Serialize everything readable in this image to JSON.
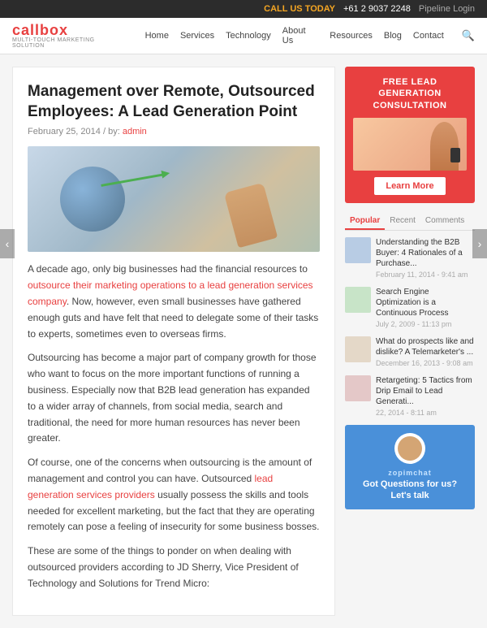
{
  "topbar": {
    "call_label": "CALL US TODAY",
    "phone": "+61 2 9037 2248",
    "pipeline_label": "Pipeline Login"
  },
  "nav": {
    "logo": "callbox",
    "logo_sub": "MULTI-TOUCH MARKETING SOLUTION",
    "links": [
      "Home",
      "Services",
      "Technology",
      "About Us",
      "Resources",
      "Blog",
      "Contact"
    ]
  },
  "article": {
    "title": "Management over Remote, Outsourced Employees: A Lead Generation Point",
    "date": "February 25, 2014",
    "separator": "/",
    "by_label": "by:",
    "author": "admin",
    "paragraphs": [
      "A decade ago, only big businesses had the financial resources to outsource their marketing operations to a lead generation services company. Now, however, even small businesses have gathered enough guts and have felt that need to delegate some of their tasks to experts, sometimes even to overseas firms.",
      "Outsourcing has become a major part of company growth for those who want to focus on the more important functions of running a business. Especially now that B2B lead generation has expanded to a wider array of channels, from social media, search and traditional, the need for more human resources has never been greater.",
      "Of course, one of the concerns when outsourcing is the amount of management and control you can have. Outsourced lead generation services providers usually possess the skills and tools needed for excellent marketing, but the fact that they are operating remotely can pose a feeling of insecurity for some business bosses.",
      "These are some of the things to ponder on when dealing with outsourced providers according to JD Sherry, Vice President of Technology and Solutions for Trend Micro:"
    ],
    "link1": "outsource their marketing operations to a lead generation services company",
    "link2": "lead generation services providers"
  },
  "sidebar": {
    "ad": {
      "title": "FREE LEAD GENERATION CONSULTATION",
      "learn_more": "Learn More"
    },
    "tabs": [
      "Popular",
      "Recent",
      "Comments"
    ],
    "active_tab": "Popular",
    "posts": [
      {
        "title": "Understanding the B2B Buyer: 4 Rationales of a Purchase...",
        "date": "February 11, 2014 - 9:41 am"
      },
      {
        "title": "Search Engine Optimization is a Continuous Process",
        "date": "July 2, 2009 - 11:13 pm"
      },
      {
        "title": "What do prospects like and dislike? A Telemarketer's ...",
        "date": "December 16, 2013 - 9:08 am"
      },
      {
        "title": "Retargeting: 5 Tactics from Drip Email to Lead Generati...",
        "date": "22, 2014 - 8:11 am"
      }
    ],
    "chat": {
      "brand": "zopimchat",
      "text": "Got Questions for us? Let's talk"
    }
  }
}
